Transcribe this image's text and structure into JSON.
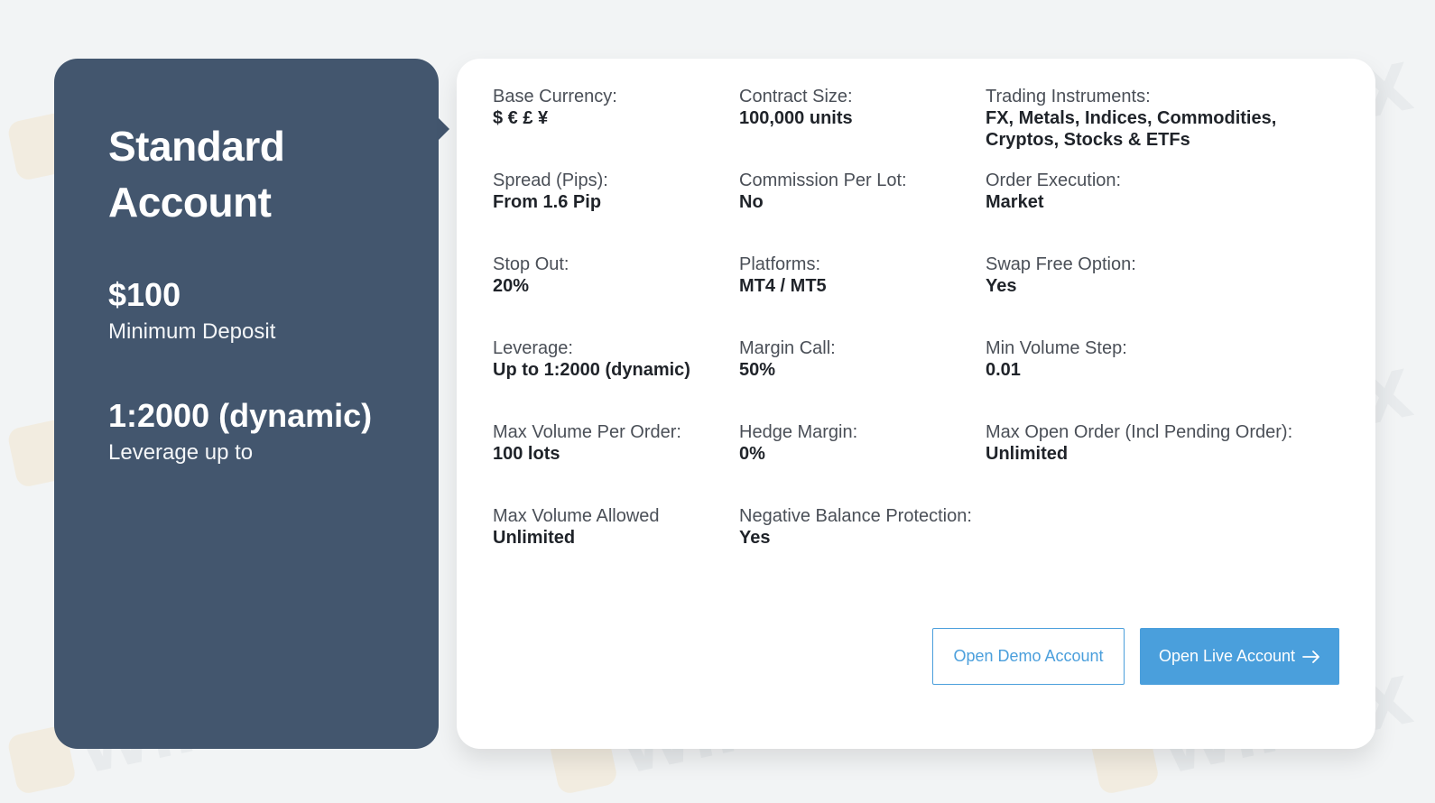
{
  "account": {
    "title": "Standard Account",
    "minimum_deposit_value": "$100",
    "minimum_deposit_label": "Minimum Deposit",
    "leverage_value": "1:2000 (dynamic)",
    "leverage_label": "Leverage up to"
  },
  "specs": [
    {
      "label": "Base Currency:",
      "value": "$ € £ ¥"
    },
    {
      "label": "Contract Size:",
      "value": "100,000 units"
    },
    {
      "label": "Trading Instruments:",
      "value": "FX, Metals, Indices, Commodities, Cryptos, Stocks & ETFs"
    },
    {
      "label": "Spread (Pips):",
      "value": "From 1.6 Pip"
    },
    {
      "label": "Commission Per Lot:",
      "value": "No"
    },
    {
      "label": "Order Execution:",
      "value": "Market"
    },
    {
      "label": "Stop Out:",
      "value": "20%"
    },
    {
      "label": "Platforms:",
      "value": "MT4 / MT5"
    },
    {
      "label": "Swap Free Option:",
      "value": "Yes"
    },
    {
      "label": "Leverage:",
      "value": "Up to 1:2000 (dynamic)"
    },
    {
      "label": "Margin Call:",
      "value": "50%"
    },
    {
      "label": "Min Volume Step:",
      "value": "0.01"
    },
    {
      "label": "Max Volume Per Order:",
      "value": "100 lots"
    },
    {
      "label": "Hedge Margin:",
      "value": "0%"
    },
    {
      "label": "Max Open Order (Incl Pending Order):",
      "value": "Unlimited"
    },
    {
      "label": "Max Volume Allowed",
      "value": "Unlimited"
    },
    {
      "label": "Negative Balance Protection:",
      "value": "Yes"
    }
  ],
  "buttons": {
    "demo_label": "Open Demo Account",
    "live_label": "Open Live Account"
  },
  "watermark": {
    "text": "WikiFX"
  },
  "colors": {
    "panel": "#43566e",
    "accent": "#4a9fdc"
  }
}
